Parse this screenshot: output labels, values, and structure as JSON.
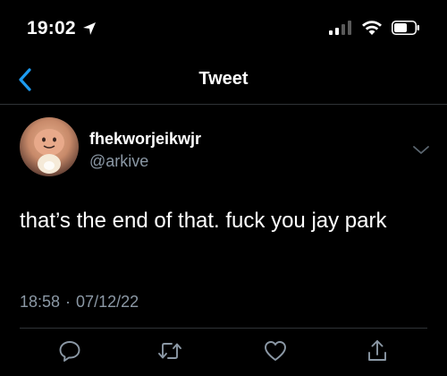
{
  "status_bar": {
    "time": "19:02",
    "location_icon": "location-arrow-icon",
    "signal_icon": "cellular-signal-icon",
    "wifi_icon": "wifi-icon",
    "battery_icon": "battery-icon"
  },
  "nav": {
    "back_icon": "chevron-left-icon",
    "title": "Tweet"
  },
  "tweet": {
    "author_name": "fhekworjeikwjr",
    "author_handle": "@arkive",
    "text": "that’s the end of that. fuck you jay park",
    "time": "18:58",
    "separator": "·",
    "date": "07/12/22"
  },
  "actions": {
    "reply_icon": "reply-icon",
    "retweet_icon": "retweet-icon",
    "like_icon": "heart-icon",
    "share_icon": "share-icon"
  },
  "colors": {
    "background": "#000000",
    "text": "#ffffff",
    "secondary": "#8b98a5",
    "accent": "#1d9bf0",
    "divider": "#2f3336"
  }
}
